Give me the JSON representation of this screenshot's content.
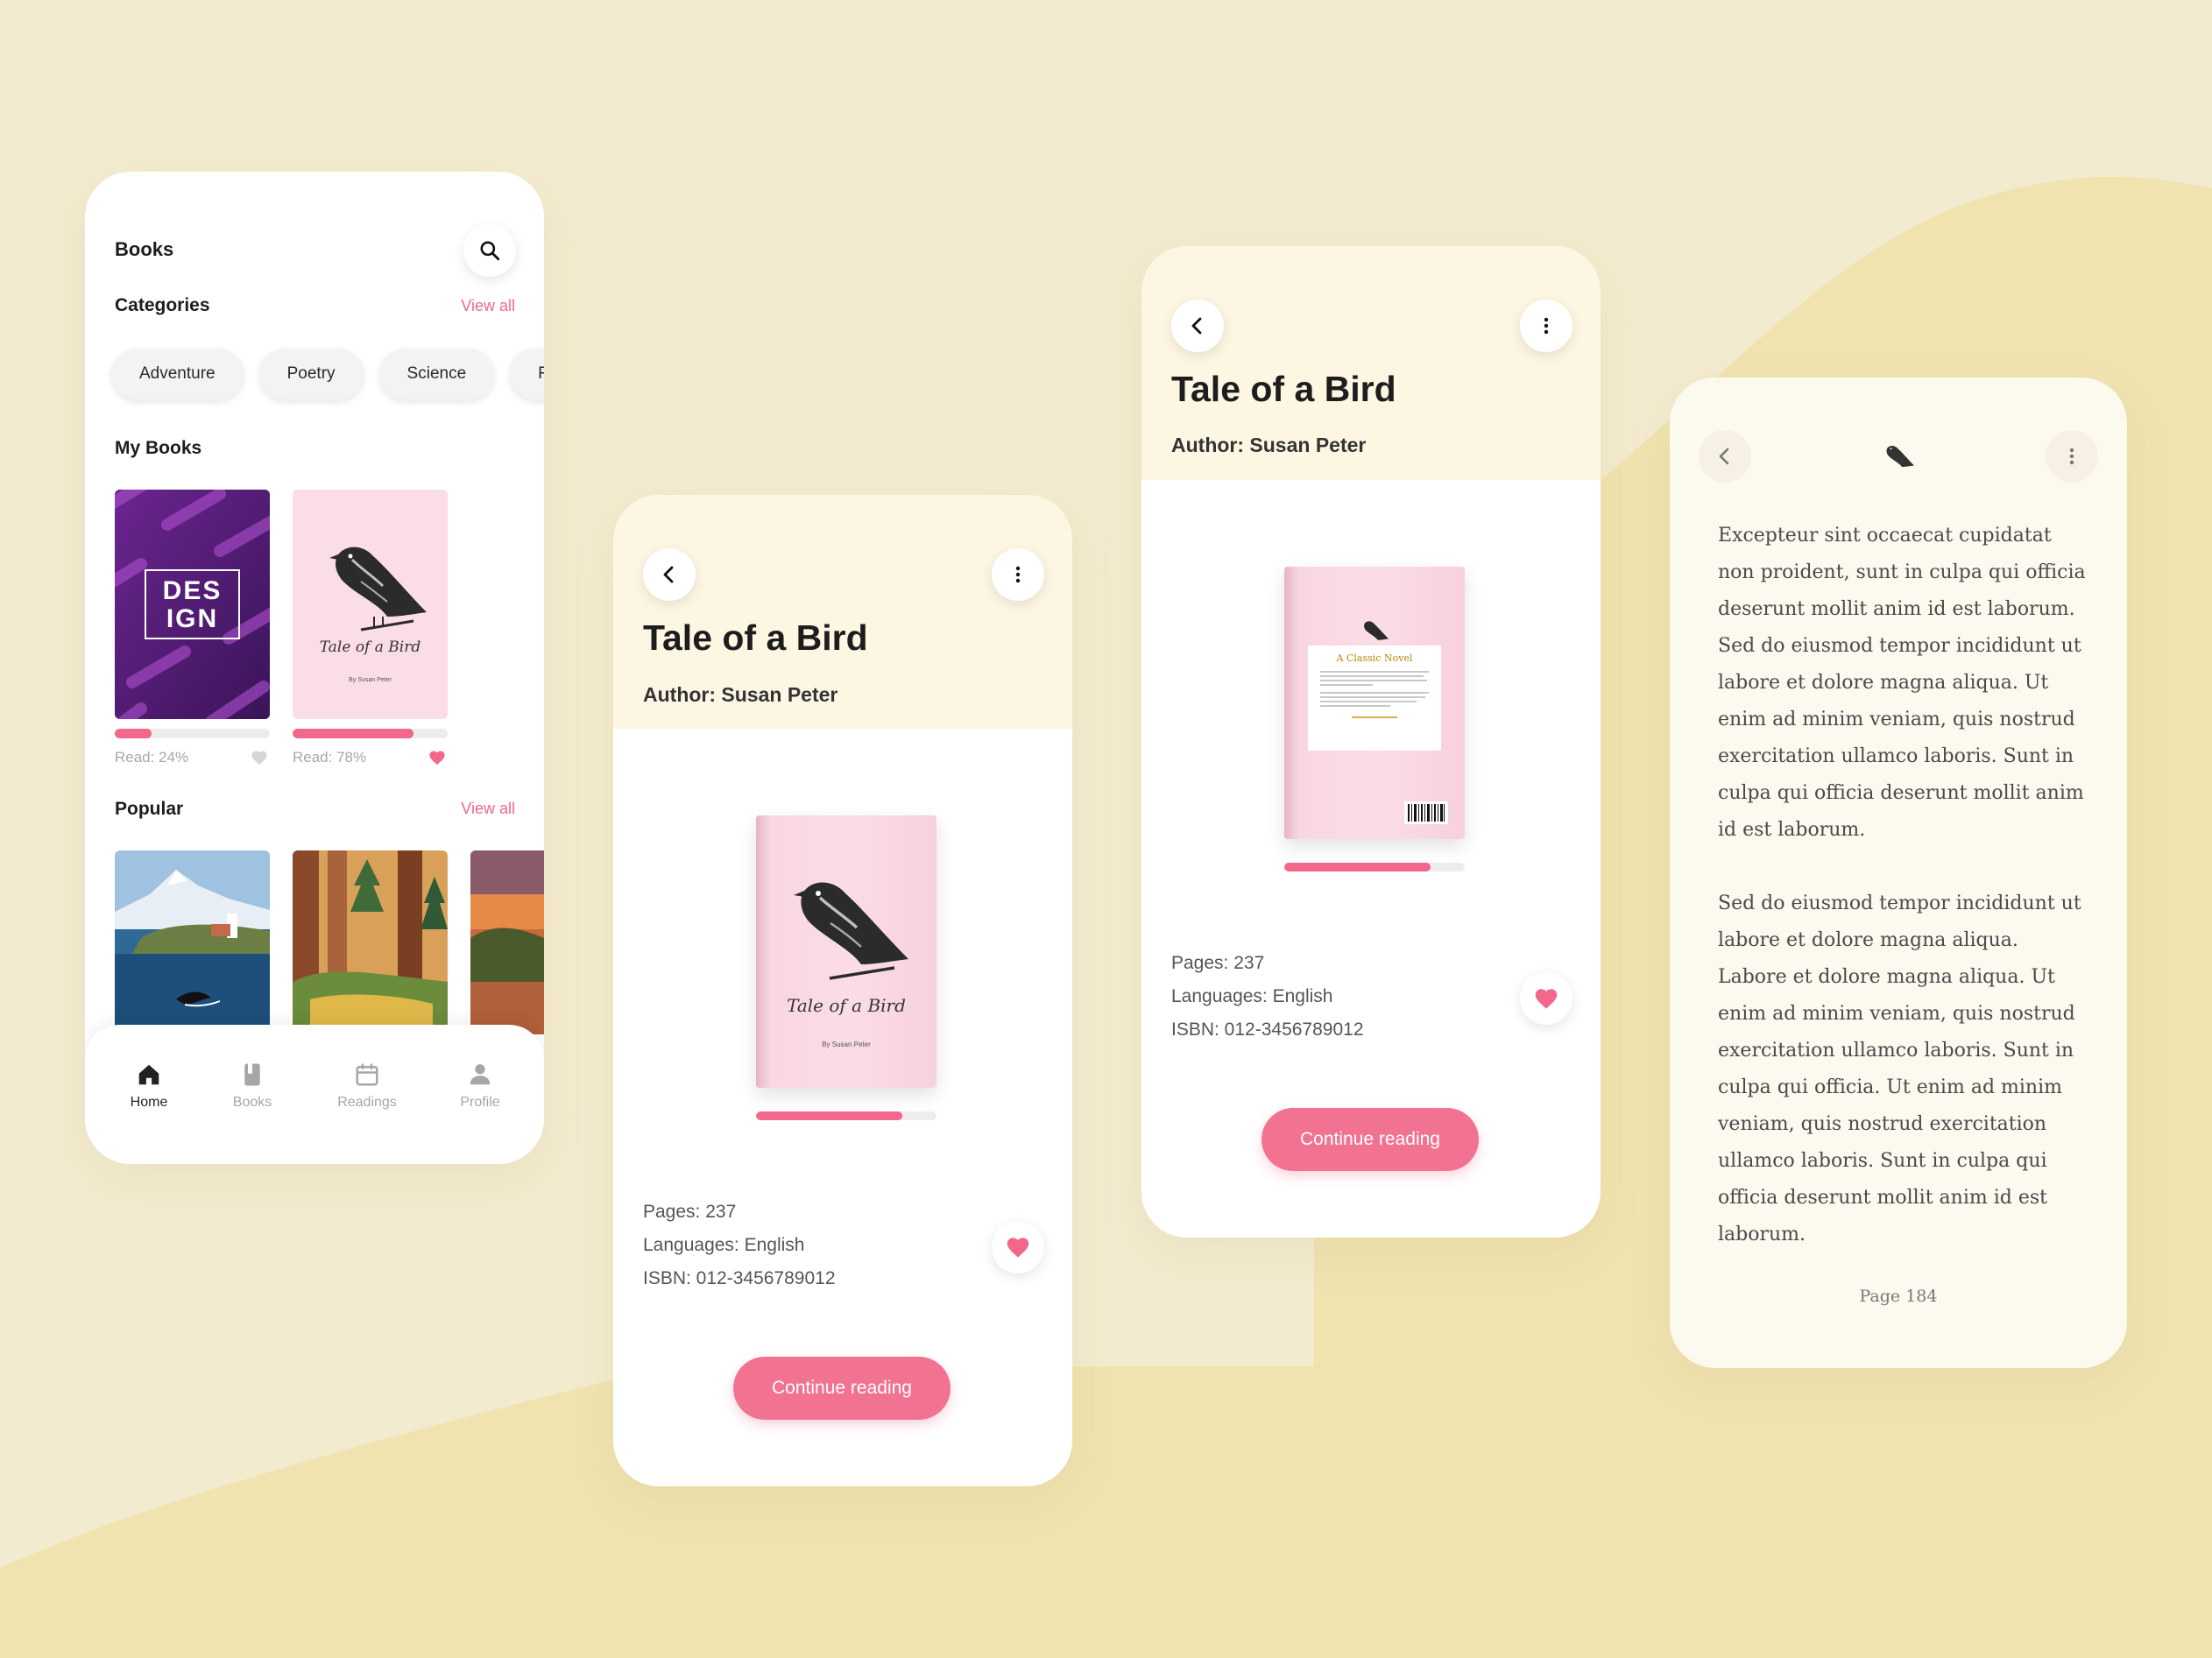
{
  "home": {
    "title": "Books",
    "categories_title": "Categories",
    "view_all": "View all",
    "categories": [
      "Adventure",
      "Poetry",
      "Science",
      "Re"
    ],
    "my_books_title": "My Books",
    "my_books": [
      {
        "cover_text": "DES IGN",
        "cover_line1": "DES",
        "cover_line2": "IGN",
        "read_label": "Read: 24%",
        "progress": 0.24,
        "liked": false
      },
      {
        "cover_title": "Tale of a Bird",
        "cover_byline": "By Susan Peter",
        "read_label": "Read: 78%",
        "progress": 0.78,
        "liked": true
      }
    ],
    "popular_title": "Popular",
    "popular_view_all": "View all",
    "tabs": [
      {
        "label": "Home",
        "icon": "home-icon",
        "active": true
      },
      {
        "label": "Books",
        "icon": "book-icon",
        "active": false
      },
      {
        "label": "Readings",
        "icon": "calendar-icon",
        "active": false
      },
      {
        "label": "Profile",
        "icon": "profile-icon",
        "active": false
      }
    ]
  },
  "detail": {
    "title": "Tale of a Bird",
    "author": "Author: Susan Peter",
    "pages": "Pages: 237",
    "languages": "Languages: English",
    "isbn": "ISBN: 012-3456789012",
    "cta": "Continue reading",
    "progress": 0.8,
    "cover_title": "Tale of a Bird",
    "cover_byline": "By Susan Peter",
    "back_cover_heading": "A Classic Novel"
  },
  "reader": {
    "paragraph1": "Excepteur sint occaecat cupidatat non proident, sunt in culpa qui officia deserunt mollit anim id est laborum. Sed do eiusmod tempor incididunt ut labore et dolore magna aliqua. Ut enim ad minim veniam, quis nostrud exercitation ullamco laboris. Sunt in culpa qui officia deserunt mollit anim id est laborum.",
    "paragraph2": "Sed do eiusmod tempor incididunt ut labore et dolore magna aliqua. Labore et dolore magna aliqua. Ut enim ad minim veniam, quis nostrud exercitation ullamco laboris. Sunt in culpa qui officia. Ut enim ad minim veniam, quis nostrud exercitation ullamco laboris. Sunt in culpa qui officia deserunt mollit anim id est laborum.",
    "page_label": "Page 184"
  },
  "colors": {
    "background": "#f3ebcf",
    "accent_pink": "#f2678a",
    "header_cream": "#fcf6e2",
    "wave": "#f0e3b0"
  }
}
